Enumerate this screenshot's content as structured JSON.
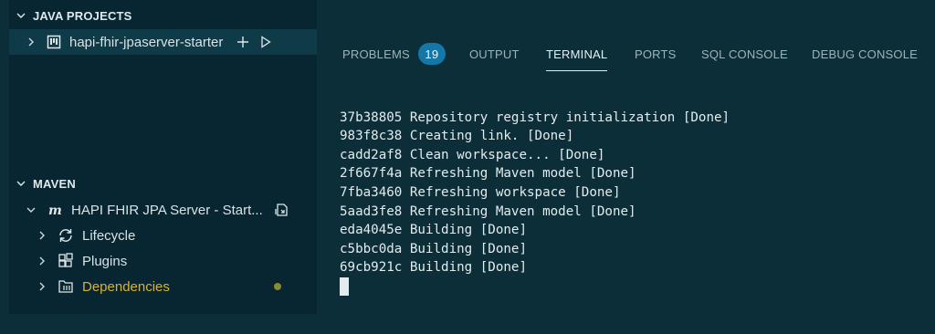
{
  "sidebar": {
    "java_projects": {
      "header": "JAVA PROJECTS",
      "project_name": "hapi-fhir-jpaserver-starter"
    },
    "maven": {
      "header": "MAVEN",
      "project_name": "HAPI FHIR JPA Server - Start...",
      "items": [
        {
          "label": "Lifecycle"
        },
        {
          "label": "Plugins"
        },
        {
          "label": "Dependencies"
        }
      ]
    }
  },
  "panel": {
    "tabs": [
      {
        "label": "PROBLEMS",
        "badge": "19"
      },
      {
        "label": "OUTPUT"
      },
      {
        "label": "TERMINAL"
      },
      {
        "label": "PORTS"
      },
      {
        "label": "SQL CONSOLE"
      },
      {
        "label": "DEBUG CONSOLE"
      }
    ],
    "active_tab": "TERMINAL",
    "terminal_lines": [
      "37b38805 Repository registry initialization [Done]",
      "983f8c38 Creating link. [Done]",
      "cadd2af8 Clean workspace... [Done]",
      "2f667f4a Refreshing Maven model [Done]",
      "7fba3460 Refreshing workspace [Done]",
      "5aad3fe8 Refreshing Maven model [Done]",
      "eda4045e Building [Done]",
      "c5bbc0da Building [Done]",
      "69cb921c Building [Done]"
    ]
  },
  "colors": {
    "background": "#0b2e38",
    "sidebar": "#082631",
    "badge": "#1577a8",
    "dependencies_label": "#d3b33a",
    "status_dot": "#8a8a2e"
  }
}
